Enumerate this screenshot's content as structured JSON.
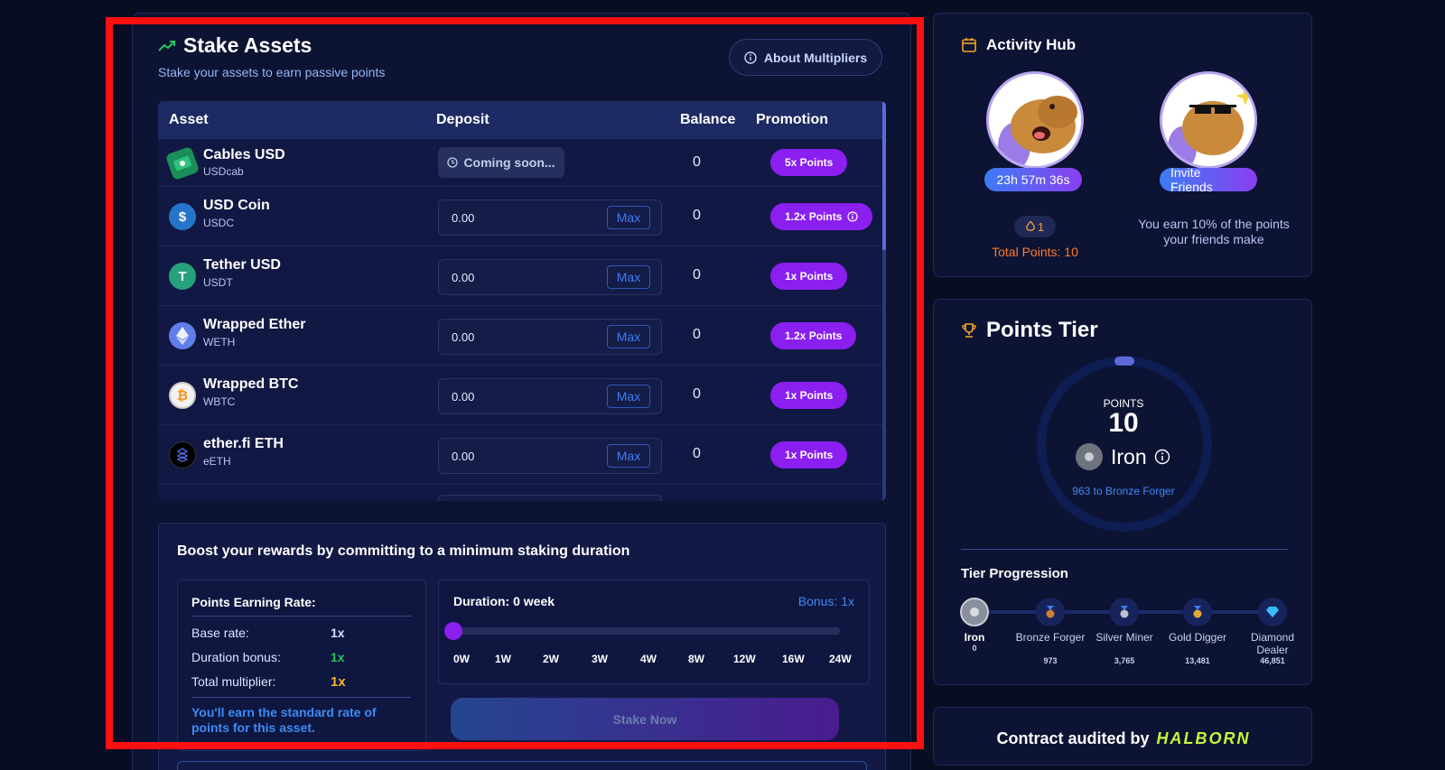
{
  "stake": {
    "title": "Stake Assets",
    "subtitle": "Stake your assets to earn passive points",
    "about_label": "About Multipliers",
    "headers": {
      "asset": "Asset",
      "deposit": "Deposit",
      "balance": "Balance",
      "promotion": "Promotion"
    },
    "rows": [
      {
        "name": "Cables USD",
        "symbol": "USDcab",
        "deposit": "Coming soon...",
        "balance": "0",
        "promotion": "5x Points",
        "icon": "cables-usd-icon"
      },
      {
        "name": "USD Coin",
        "symbol": "USDC",
        "deposit": "0.00",
        "max": "Max",
        "balance": "0",
        "promotion": "1.2x Points",
        "icon": "usdc-icon"
      },
      {
        "name": "Tether USD",
        "symbol": "USDT",
        "deposit": "0.00",
        "max": "Max",
        "balance": "0",
        "promotion": "1x Points",
        "icon": "tether-icon"
      },
      {
        "name": "Wrapped Ether",
        "symbol": "WETH",
        "deposit": "0.00",
        "max": "Max",
        "balance": "0",
        "promotion": "1.2x Points",
        "icon": "ether-icon"
      },
      {
        "name": "Wrapped BTC",
        "symbol": "WBTC",
        "deposit": "0.00",
        "max": "Max",
        "balance": "0",
        "promotion": "1x Points",
        "icon": "bitcoin-icon"
      },
      {
        "name": "ether.fi ETH",
        "symbol": "eETH",
        "deposit": "0.00",
        "max": "Max",
        "balance": "0",
        "promotion": "1x Points",
        "icon": "etherfi-icon"
      }
    ]
  },
  "boost": {
    "title": "Boost your rewards by committing to a minimum staking duration",
    "rate_title": "Points Earning Rate:",
    "base_label": "Base rate:",
    "base_value": "1x",
    "duration_label": "Duration bonus:",
    "duration_value": "1x",
    "total_label": "Total multiplier:",
    "total_value": "1x",
    "note": "You'll earn the standard rate of points for this asset.",
    "duration_text": "Duration: 0 week",
    "bonus_text": "Bonus: 1x",
    "slider_value": 0,
    "ticks": [
      "0W",
      "1W",
      "2W",
      "3W",
      "4W",
      "8W",
      "12W",
      "16W",
      "24W"
    ],
    "stake_button": "Stake Now"
  },
  "activity": {
    "title": "Activity Hub",
    "timer": "23h 57m 36s",
    "invite_label": "Invite Friends",
    "streak": "1",
    "total_points": "Total Points: 10",
    "friends_note": "You earn 10% of the points your friends make"
  },
  "tier": {
    "title": "Points Tier",
    "points_label": "POINTS",
    "points_value": "10",
    "current_tier": "Iron",
    "next_text": "963 to Bronze Forger",
    "progression_title": "Tier Progression",
    "levels": [
      {
        "name": "Iron",
        "points": "0"
      },
      {
        "name": "Bronze Forger",
        "points": "973"
      },
      {
        "name": "Silver Miner",
        "points": "3,765"
      },
      {
        "name": "Gold Digger",
        "points": "13,481"
      },
      {
        "name": "Diamond Dealer",
        "points": "46,851"
      }
    ]
  },
  "audit": {
    "text": "Contract audited by",
    "brand": "HALBORN"
  },
  "colors": {
    "background": "#090d24",
    "accent_purple": "#8a1ff0",
    "accent_blue": "#3d8bf5",
    "highlight_red": "#ff1010"
  }
}
